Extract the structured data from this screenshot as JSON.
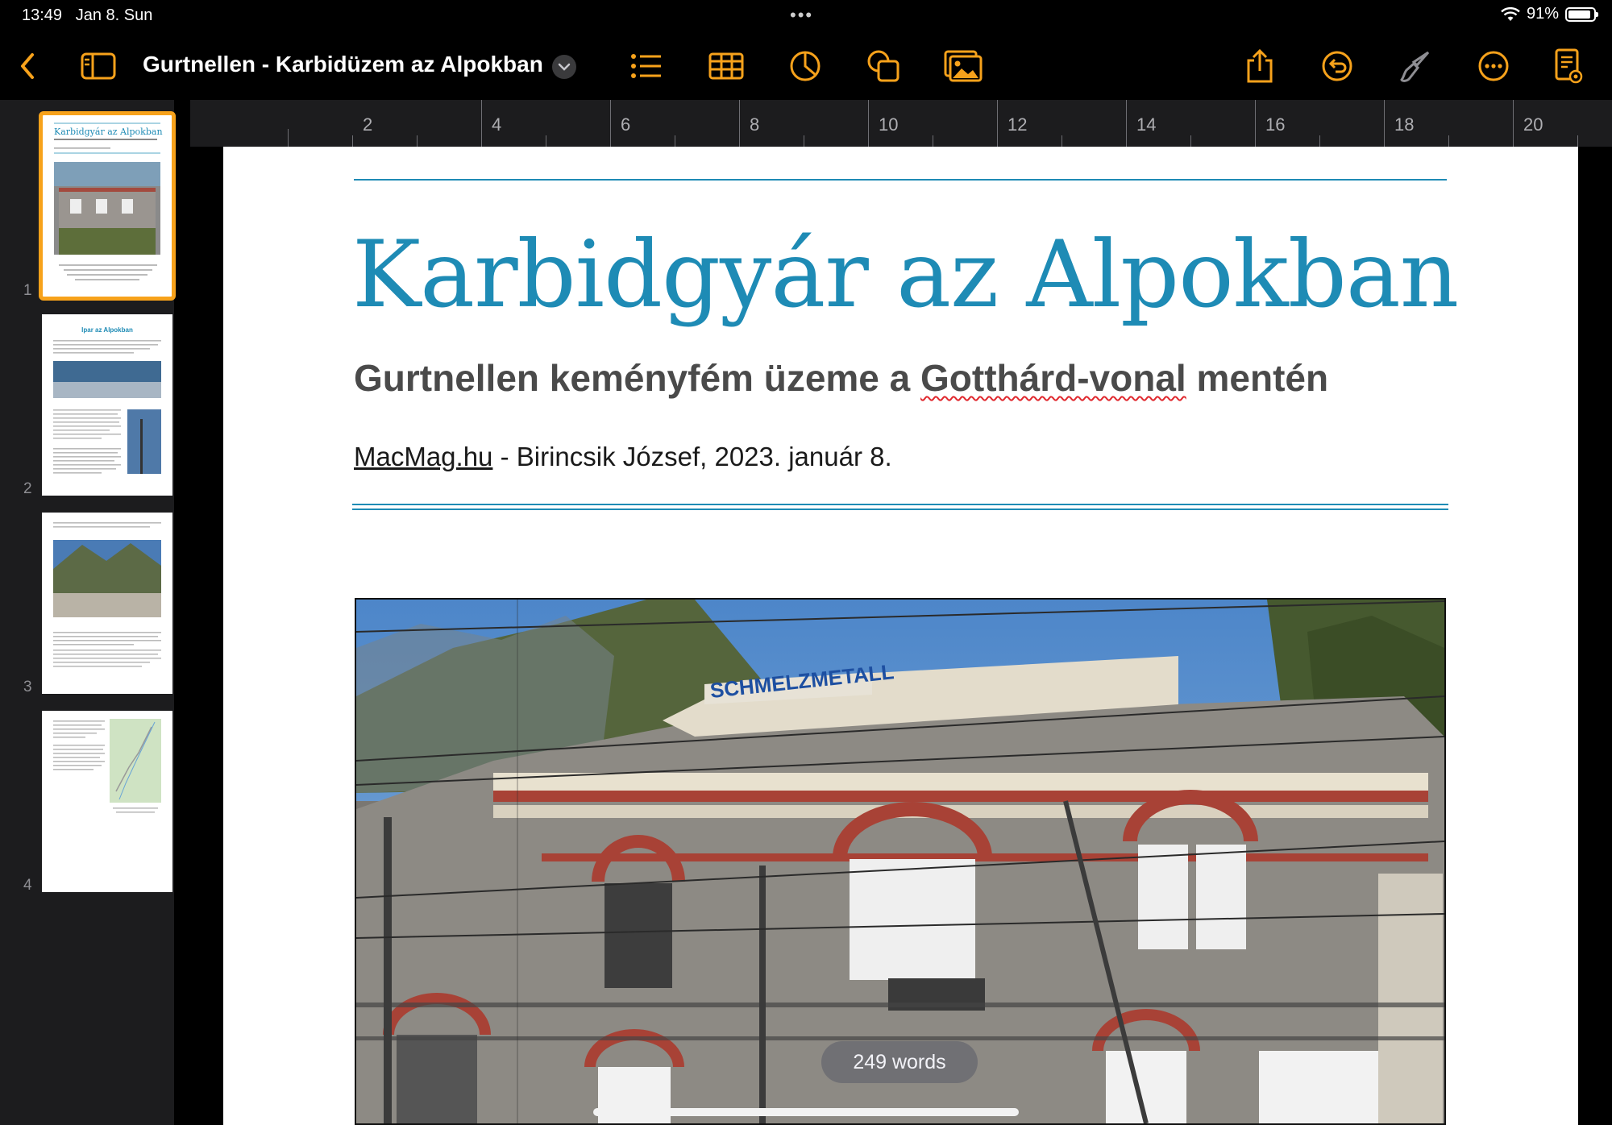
{
  "status_bar": {
    "time": "13:49",
    "date": "Jan 8. Sun",
    "battery": "91%"
  },
  "toolbar": {
    "back_icon": "chevron-left-icon",
    "title": "Gurtnellen - Karbidüzem az Alpokban",
    "buttons": [
      "sidebar-icon",
      "list-icon",
      "table-icon",
      "chart-icon",
      "shapes-icon",
      "media-icon",
      "share-icon",
      "undo-icon",
      "paintbrush-icon",
      "more-icon",
      "document-icon"
    ],
    "accent": "#f7a21b"
  },
  "sidebar": {
    "pages": [
      {
        "number": "1",
        "title": "Karbidgyár az Alpokban",
        "selected": true
      },
      {
        "number": "2",
        "title": "Ipar az Alpokban",
        "selected": false
      },
      {
        "number": "3",
        "title": "",
        "selected": false
      },
      {
        "number": "4",
        "title": "",
        "selected": false
      }
    ]
  },
  "ruler": {
    "labels": [
      "2",
      "4",
      "6",
      "8",
      "10",
      "12",
      "14",
      "16",
      "18",
      "20"
    ]
  },
  "document": {
    "title": "Karbidgyár az Alpokban",
    "subtitle_pre": "Gurtnellen keményfém üzeme a ",
    "subtitle_flagged": "Gotthárd-vonal",
    "subtitle_post": " mentén",
    "byline_link": "MacMag.hu",
    "byline_rest": " - Birincsik József, 2023. január 8.",
    "photo_sign": "SCHMELZMETALL",
    "accent": "#1e8bb5"
  },
  "word_count": "249 words"
}
